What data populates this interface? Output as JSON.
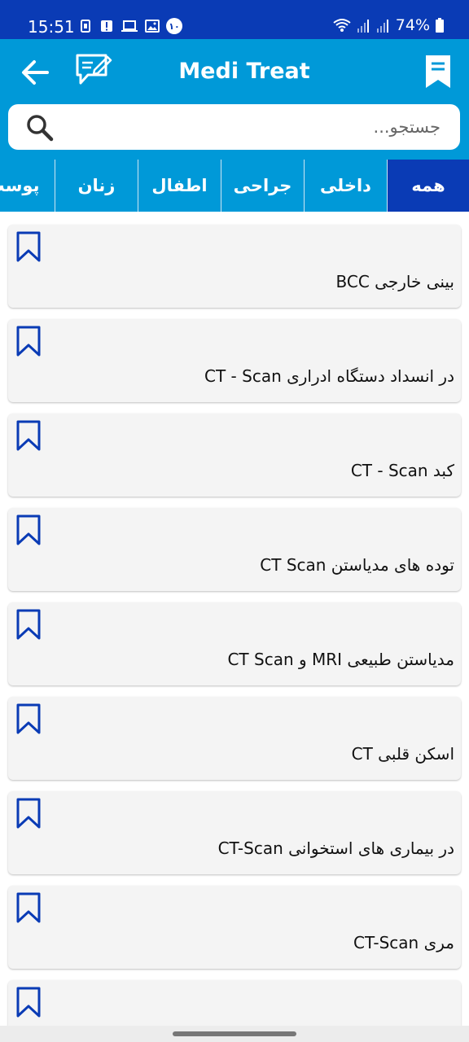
{
  "status_bar": {
    "time": "15:51",
    "notification_badge": "۱۰",
    "battery": "74%",
    "icons": [
      "sim-icon",
      "alert-icon",
      "laptop-icon",
      "image-icon",
      "badge-icon",
      "wifi-icon",
      "signal-icon",
      "signal-icon",
      "battery-icon"
    ]
  },
  "app_bar": {
    "title": "Medi Treat",
    "icons": [
      "back-arrow-icon",
      "note-edit-icon",
      "bookmark-icon"
    ]
  },
  "search": {
    "placeholder": "جستجو..."
  },
  "tabs": [
    {
      "label": "همه",
      "active": true
    },
    {
      "label": "داخلی",
      "active": false
    },
    {
      "label": "جراحی",
      "active": false
    },
    {
      "label": "اطفال",
      "active": false
    },
    {
      "label": "زنان",
      "active": false
    },
    {
      "label": "پوست",
      "active": false
    }
  ],
  "items": [
    {
      "title": "بینی  خارجی BCC"
    },
    {
      "title": "در انسداد دستگاه ادراری CT - Scan"
    },
    {
      "title": "کبد CT - Scan"
    },
    {
      "title": "توده های مدیاستن CT Scan"
    },
    {
      "title": "مدیاستن طبیعی MRI و CT Scan"
    },
    {
      "title": "اسکن قلبی CT"
    },
    {
      "title": "در بیماری های استخوانی CT-Scan"
    },
    {
      "title": "مری CT-Scan"
    },
    {
      "title": ""
    }
  ],
  "colors": {
    "status_bar": "#0a3bb5",
    "app_bar": "#0099d8",
    "active_tab": "#0a3bb5",
    "bookmark_outline": "#0a3bb5",
    "card_bg": "#f4f4f4"
  }
}
